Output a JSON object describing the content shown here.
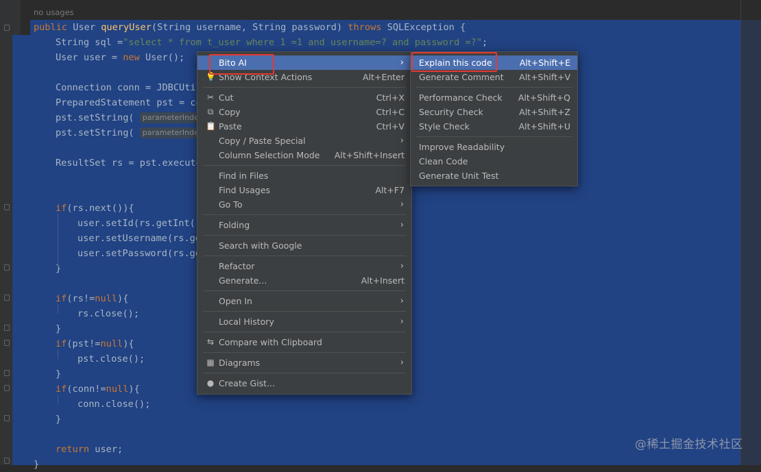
{
  "editor": {
    "usages_hint": "no usages",
    "lines": [
      {
        "tokens": [
          [
            "kw",
            "public "
          ],
          [
            "",
            "User "
          ],
          [
            "fn",
            "queryUser"
          ],
          [
            "",
            "(String username, String password) "
          ],
          [
            "kw",
            "throws "
          ],
          [
            "",
            "SQLException {"
          ]
        ]
      },
      {
        "tokens": [
          [
            "",
            "String sql ="
          ],
          [
            "str",
            "\"select * from t_user where 1 =1 and username=? and password =?\""
          ],
          [
            "",
            "; "
          ]
        ]
      },
      {
        "tokens": [
          [
            "",
            "User user = "
          ],
          [
            "kw",
            "new "
          ],
          [
            "",
            "User();"
          ]
        ]
      },
      {
        "tokens": []
      },
      {
        "tokens": [
          [
            "",
            "Connection conn = JDBCUtil"
          ]
        ]
      },
      {
        "tokens": [
          [
            "",
            "PreparedStatement pst = co"
          ]
        ]
      },
      {
        "tokens": [
          [
            "",
            "pst.setString( "
          ],
          [
            "hint",
            "parameterInde"
          ]
        ]
      },
      {
        "tokens": [
          [
            "",
            "pst.setString( "
          ],
          [
            "hint",
            "parameterInde"
          ]
        ]
      },
      {
        "tokens": []
      },
      {
        "tokens": [
          [
            "",
            "ResultSet rs = pst.execute"
          ]
        ]
      },
      {
        "tokens": []
      },
      {
        "tokens": []
      },
      {
        "tokens": [
          [
            "kw",
            "if"
          ],
          [
            "",
            "(rs.next()){"
          ]
        ]
      },
      {
        "tokens": [
          [
            "",
            "user.setId(rs.getInt( "
          ]
        ]
      },
      {
        "tokens": [
          [
            "",
            "user.setUsername(rs.ge"
          ]
        ]
      },
      {
        "tokens": [
          [
            "",
            "user.setPassword(rs.ge"
          ]
        ]
      },
      {
        "tokens": [
          [
            "",
            "}"
          ]
        ]
      },
      {
        "tokens": []
      },
      {
        "tokens": [
          [
            "kw",
            "if"
          ],
          [
            "",
            "(rs!="
          ],
          [
            "kw",
            "null"
          ],
          [
            "",
            "){"
          ]
        ]
      },
      {
        "tokens": [
          [
            "",
            "rs.close();"
          ]
        ]
      },
      {
        "tokens": [
          [
            "",
            "}"
          ]
        ]
      },
      {
        "tokens": [
          [
            "kw",
            "if"
          ],
          [
            "",
            "(pst!="
          ],
          [
            "kw",
            "null"
          ],
          [
            "",
            "){"
          ]
        ]
      },
      {
        "tokens": [
          [
            "",
            "pst.close();"
          ]
        ]
      },
      {
        "tokens": [
          [
            "",
            "}"
          ]
        ]
      },
      {
        "tokens": [
          [
            "kw",
            "if"
          ],
          [
            "",
            "(conn!="
          ],
          [
            "kw",
            "null"
          ],
          [
            "",
            "){"
          ]
        ]
      },
      {
        "tokens": [
          [
            "",
            "conn.close();"
          ]
        ]
      },
      {
        "tokens": [
          [
            "",
            "}"
          ]
        ]
      },
      {
        "tokens": []
      },
      {
        "tokens": [
          [
            "kw",
            "return "
          ],
          [
            "",
            "user;"
          ]
        ]
      },
      {
        "tokens": [
          [
            "",
            "}"
          ]
        ]
      }
    ]
  },
  "context_menu": {
    "items": [
      {
        "label": "Bito AI",
        "icon": "",
        "shortcut": "",
        "submenu": true,
        "active": true
      },
      {
        "label": "Show Context Actions",
        "icon": "bulb-icon",
        "shortcut": "Alt+Enter",
        "submenu": false
      },
      {
        "separator": true
      },
      {
        "label": "Cut",
        "icon": "scissors-icon",
        "shortcut": "Ctrl+X",
        "submenu": false
      },
      {
        "label": "Copy",
        "icon": "copy-icon",
        "shortcut": "Ctrl+C",
        "submenu": false
      },
      {
        "label": "Paste",
        "icon": "clipboard-icon",
        "shortcut": "Ctrl+V",
        "submenu": false
      },
      {
        "label": "Copy / Paste Special",
        "icon": "",
        "shortcut": "",
        "submenu": true
      },
      {
        "label": "Column Selection Mode",
        "icon": "",
        "shortcut": "Alt+Shift+Insert",
        "submenu": false
      },
      {
        "separator": true
      },
      {
        "label": "Find in Files",
        "icon": "",
        "shortcut": "",
        "submenu": false
      },
      {
        "label": "Find Usages",
        "icon": "",
        "shortcut": "Alt+F7",
        "submenu": false
      },
      {
        "label": "Go To",
        "icon": "",
        "shortcut": "",
        "submenu": true
      },
      {
        "separator": true
      },
      {
        "label": "Folding",
        "icon": "",
        "shortcut": "",
        "submenu": true
      },
      {
        "separator": true
      },
      {
        "label": "Search with Google",
        "icon": "",
        "shortcut": "",
        "submenu": false
      },
      {
        "separator": true
      },
      {
        "label": "Refactor",
        "icon": "",
        "shortcut": "",
        "submenu": true
      },
      {
        "label": "Generate...",
        "icon": "",
        "shortcut": "Alt+Insert",
        "submenu": false
      },
      {
        "separator": true
      },
      {
        "label": "Open In",
        "icon": "",
        "shortcut": "",
        "submenu": true
      },
      {
        "separator": true
      },
      {
        "label": "Local History",
        "icon": "",
        "shortcut": "",
        "submenu": true
      },
      {
        "separator": true
      },
      {
        "label": "Compare with Clipboard",
        "icon": "compare-icon",
        "shortcut": "",
        "submenu": false
      },
      {
        "separator": true
      },
      {
        "label": "Diagrams",
        "icon": "diagram-icon",
        "shortcut": "",
        "submenu": true
      },
      {
        "separator": true
      },
      {
        "label": "Create Gist...",
        "icon": "github-icon",
        "shortcut": "",
        "submenu": false
      }
    ]
  },
  "submenu": {
    "items": [
      {
        "label": "Explain this code",
        "shortcut": "Alt+Shift+E",
        "active": true
      },
      {
        "label": "Generate Comment",
        "shortcut": "Alt+Shift+V"
      },
      {
        "separator": true
      },
      {
        "label": "Performance Check",
        "shortcut": "Alt+Shift+Q"
      },
      {
        "label": "Security Check",
        "shortcut": "Alt+Shift+Z"
      },
      {
        "label": "Style Check",
        "shortcut": "Alt+Shift+U"
      },
      {
        "separator": true
      },
      {
        "label": "Improve Readability",
        "shortcut": ""
      },
      {
        "label": "Clean Code",
        "shortcut": ""
      },
      {
        "label": "Generate Unit Test",
        "shortcut": ""
      }
    ]
  },
  "watermark": "@稀土掘金技术社区",
  "colors": {
    "selection": "#214283",
    "menu_bg": "#3c3f41",
    "menu_active": "#4b6eaf",
    "highlight_box": "#e53935"
  }
}
